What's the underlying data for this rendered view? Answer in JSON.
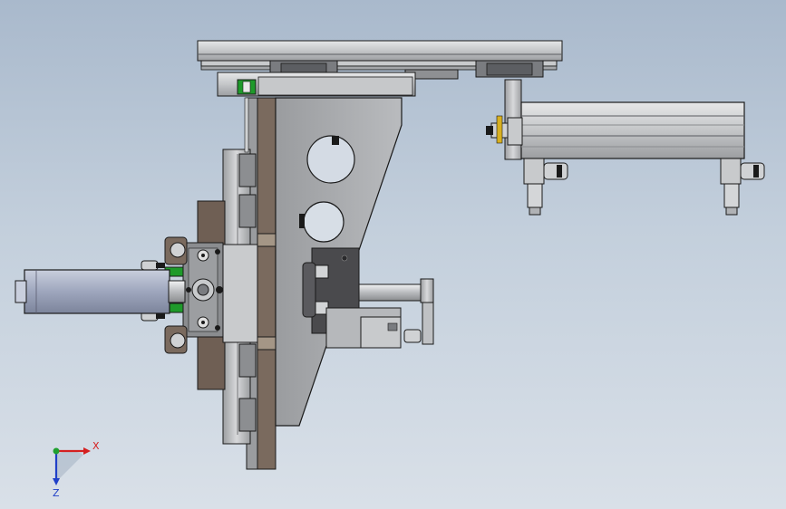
{
  "viewport": {
    "background_top": "#a9b9cc",
    "background_bottom": "#d9e0e8"
  },
  "colors": {
    "steel_light": "#d2d4d6",
    "steel_mid": "#a9abae",
    "steel_dark": "#6e7074",
    "plate_brown": "#7a6a5e",
    "bracket_black": "#4a4a4d",
    "fitting_green": "#1e9a2a",
    "cylinder_blue": "#9ea6bd",
    "edge": "#1a1a1a",
    "axis_x": "#d42020",
    "axis_y": "#20a030",
    "axis_z": "#2040c8"
  },
  "triad": {
    "x_label": "X",
    "z_label": "Z",
    "icons": [
      "axis-x-arrow-icon",
      "axis-z-arrow-icon",
      "origin-sphere-icon"
    ]
  }
}
